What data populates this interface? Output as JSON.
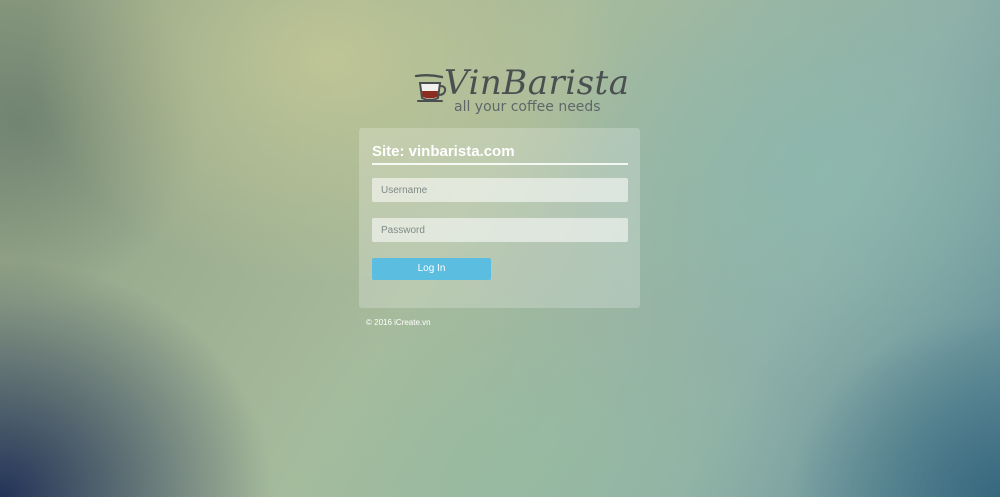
{
  "logo": {
    "name": "VinBarista",
    "tagline": "all your coffee needs",
    "icon": "coffee-cup-icon"
  },
  "panel": {
    "site_title": "Site: vinbarista.com"
  },
  "form": {
    "username": {
      "value": "",
      "placeholder": "Username"
    },
    "password": {
      "value": "",
      "placeholder": "Password"
    },
    "login_label": "Log In"
  },
  "footer": {
    "copyright": "© 2016 iCreate.vn"
  },
  "colors": {
    "button": "#5bbde0",
    "logo_text": "#4a4f50",
    "cup_coffee": "#8b2e1f"
  }
}
